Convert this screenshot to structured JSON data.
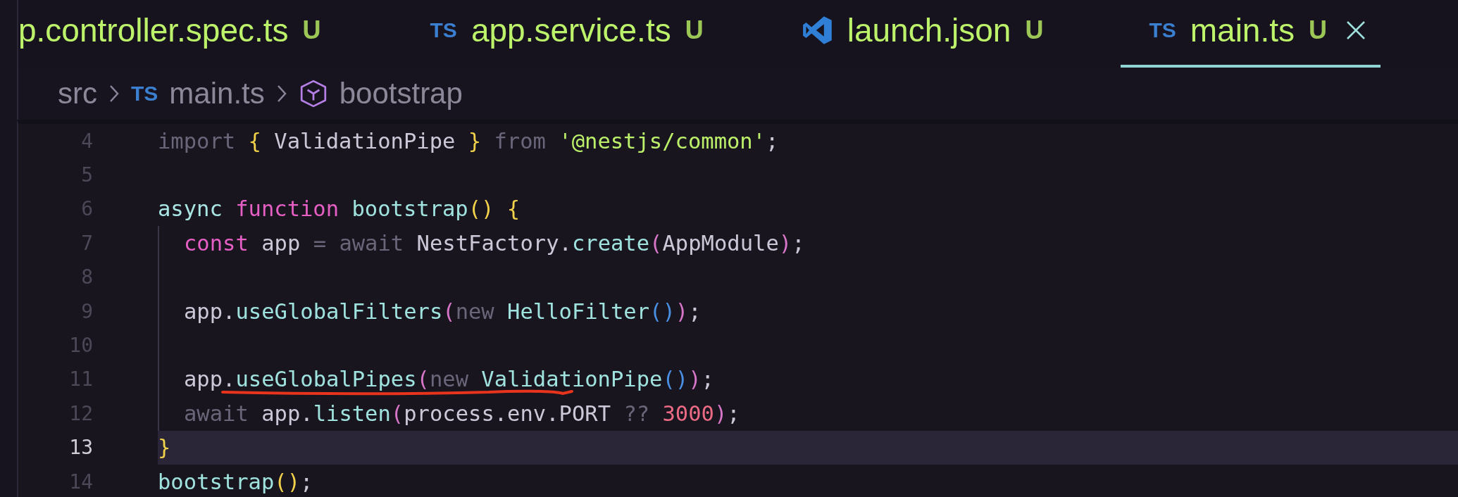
{
  "tabs": [
    {
      "kind": "plain",
      "label": "p.controller.spec.ts",
      "badge": "U",
      "selected": false
    },
    {
      "kind": "ts",
      "icon_label": "TS",
      "label": "app.service.ts",
      "badge": "U",
      "selected": false
    },
    {
      "kind": "vscode",
      "label": "launch.json",
      "badge": "U",
      "selected": false
    },
    {
      "kind": "ts",
      "icon_label": "TS",
      "label": "main.ts",
      "badge": "U",
      "selected": true
    }
  ],
  "breadcrumb": [
    {
      "kind": "folder",
      "label": "src"
    },
    {
      "kind": "ts",
      "icon_label": "TS",
      "label": "main.ts"
    },
    {
      "kind": "symbol",
      "label": "bootstrap"
    }
  ],
  "code_lines": [
    {
      "number": "4",
      "current": false,
      "tokens": [
        {
          "text": "import ",
          "kind": "muted"
        },
        {
          "text": "{",
          "kind": "brace"
        },
        {
          "text": " ValidationPipe ",
          "kind": "plain"
        },
        {
          "text": "}",
          "kind": "brace"
        },
        {
          "text": " from ",
          "kind": "muted"
        },
        {
          "text": "'@nestjs/common'",
          "kind": "string"
        },
        {
          "text": ";",
          "kind": "plain"
        }
      ]
    },
    {
      "number": "5",
      "current": false
    },
    {
      "number": "6",
      "current": false,
      "tokens": [
        {
          "text": "async ",
          "kind": "type"
        },
        {
          "text": "function ",
          "kind": "keyword"
        },
        {
          "text": "bootstrap",
          "kind": "func"
        },
        {
          "text": "()",
          "kind": "brace"
        },
        {
          "text": " {",
          "kind": "brace"
        }
      ],
      "children": [
        {
          "number": "7",
          "current": false,
          "tokens": [
            {
              "text": "const",
              "kind": "keyword"
            },
            {
              "text": " app ",
              "kind": "plain"
            },
            {
              "text": "= await",
              "kind": "muted"
            },
            {
              "text": " NestFactory.",
              "kind": "plain"
            },
            {
              "text": "create",
              "kind": "func"
            },
            {
              "text": "(",
              "kind": "paren"
            },
            {
              "text": "AppModule",
              "kind": "plain"
            },
            {
              "text": ")",
              "kind": "paren"
            },
            {
              "text": ";",
              "kind": "plain"
            }
          ]
        },
        {
          "number": "8",
          "current": false
        },
        {
          "number": "9",
          "current": false,
          "tokens": [
            {
              "text": "app.",
              "kind": "plain"
            },
            {
              "text": "useGlobalFilters",
              "kind": "func"
            },
            {
              "text": "(",
              "kind": "paren"
            },
            {
              "text": "new ",
              "kind": "muted"
            },
            {
              "text": "HelloFilter",
              "kind": "func"
            },
            {
              "text": "()",
              "kind": "inner"
            },
            {
              "text": ")",
              "kind": "paren"
            },
            {
              "text": ";",
              "kind": "plain"
            }
          ]
        },
        {
          "number": "10",
          "current": false
        },
        {
          "number": "11",
          "current": false,
          "tokens": [
            {
              "text": "app.",
              "kind": "plain"
            },
            {
              "text": "useGlobalPipes",
              "kind": "func"
            },
            {
              "text": "(",
              "kind": "paren"
            },
            {
              "text": "new ",
              "kind": "muted"
            },
            {
              "text": "ValidationPipe",
              "kind": "func"
            },
            {
              "text": "()",
              "kind": "inner"
            },
            {
              "text": ")",
              "kind": "paren"
            },
            {
              "text": ";",
              "kind": "plain"
            }
          ]
        },
        {
          "number": "12",
          "current": false,
          "tokens": [
            {
              "text": "await",
              "kind": "muted"
            },
            {
              "text": " app.",
              "kind": "plain"
            },
            {
              "text": "listen",
              "kind": "func"
            },
            {
              "text": "(",
              "kind": "paren"
            },
            {
              "text": "process.env.PORT ",
              "kind": "plain"
            },
            {
              "text": "??",
              "kind": "muted"
            },
            {
              "text": " 3000",
              "kind": "number"
            },
            {
              "text": ")",
              "kind": "paren"
            },
            {
              "text": ";",
              "kind": "plain"
            }
          ]
        }
      ]
    },
    {
      "number": "13",
      "current": true,
      "tokens": [
        {
          "text": "}",
          "kind": "brace"
        }
      ]
    },
    {
      "number": "14",
      "current": false,
      "tokens": [
        {
          "text": "bootstrap",
          "kind": "func"
        },
        {
          "text": "()",
          "kind": "brace"
        },
        {
          "text": ";",
          "kind": "plain"
        }
      ]
    }
  ]
}
